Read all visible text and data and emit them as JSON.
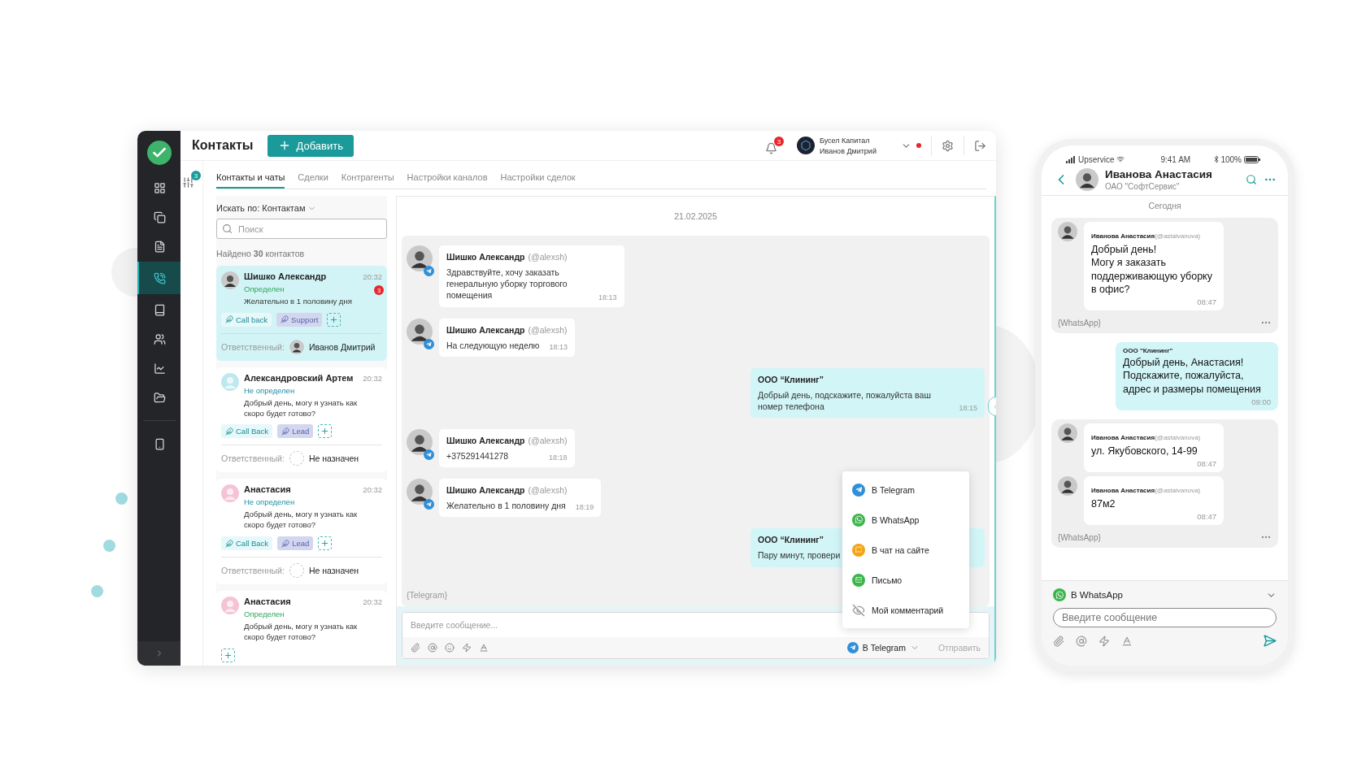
{
  "sidebar": {
    "items": [
      {
        "selected": false
      },
      {
        "selected": false
      },
      {
        "selected": false
      },
      {
        "selected": true
      },
      {
        "selected": false
      },
      {
        "selected": false
      },
      {
        "selected": false
      },
      {
        "selected": false
      },
      {
        "selected": false
      }
    ]
  },
  "header": {
    "title": "Контакты",
    "add_button": "Добавить",
    "notifications": "3",
    "company": "Бусел Капитал",
    "user": "Иванов Дмитрий"
  },
  "filter": {
    "badge": "3"
  },
  "tabs": [
    {
      "label": "Контакты и чаты",
      "selected": true
    },
    {
      "label": "Сделки",
      "selected": false
    },
    {
      "label": "Контрагенты",
      "selected": false
    },
    {
      "label": "Настройки каналов",
      "selected": false
    },
    {
      "label": "Настройки сделок",
      "selected": false
    }
  ],
  "search": {
    "label": "Искать по:",
    "value": "Контактам",
    "placeholder": "Поиск",
    "found": "Найдено **30** контактов"
  },
  "contacts": [
    {
      "name": "Шишко Александр",
      "time": "20:32",
      "avatar": {
        "kind": "photo"
      },
      "status": {
        "kind": "defined",
        "text": "Определен"
      },
      "preview": "Желательно в 1 половину дня",
      "unread": "3",
      "tags": [
        {
          "kind": "callback",
          "label": "Call back"
        },
        {
          "kind": "support",
          "label": "Support"
        }
      ],
      "owner_label": "Ответственный:",
      "owner": "Иванов Дмитрий",
      "owner_assigned": true,
      "selected": true
    },
    {
      "name": "Александровский Артем",
      "time": "20:32",
      "avatar": {
        "kind": "cartoon",
        "color": "#bfe8ee"
      },
      "status": {
        "kind": "undefined",
        "text": "Не определен"
      },
      "preview": "Добрый день, могу я узнать как скоро будет готово?",
      "tags": [
        {
          "kind": "callback",
          "label": "Call Back"
        },
        {
          "kind": "lead",
          "label": "Lead"
        }
      ],
      "owner_label": "Ответственный:",
      "owner": "Не назначен",
      "owner_assigned": false,
      "selected": false
    },
    {
      "name": "Анастасия",
      "time": "20:32",
      "avatar": {
        "kind": "cartoon",
        "color": "#f5c3d6"
      },
      "status": {
        "kind": "undefined",
        "text": "Не определен"
      },
      "preview": "Добрый день, могу я узнать как скоро будет готово?",
      "tags": [
        {
          "kind": "callback",
          "label": "Call Back"
        },
        {
          "kind": "lead",
          "label": "Lead"
        }
      ],
      "owner_label": "Ответственный:",
      "owner": "Не назначен",
      "owner_assigned": false,
      "selected": false
    },
    {
      "name": "Анастасия",
      "time": "20:32",
      "avatar": {
        "kind": "cartoon",
        "color": "#f5c3d6"
      },
      "status": {
        "kind": "defined",
        "text": "Определен"
      },
      "preview": "Добрый день, могу я узнать как скоро будет готово?",
      "selected": false
    }
  ],
  "chat": {
    "date": "21.02.2025",
    "messages": [
      {
        "kind": "in",
        "author": "Шишко Александр",
        "handle": "(@alexsh)",
        "text": "Здравствуйте, хочу заказать генеральную уборку торгового помещения",
        "time": "18:13"
      },
      {
        "kind": "in",
        "author": "Шишко Александр",
        "handle": "(@alexsh)",
        "text": "На следующую неделю",
        "time": "18:13"
      },
      {
        "kind": "out",
        "author": "ООО “Клининг”",
        "text": "Добрый день, подскажите, пожалуйста ваш номер телефона",
        "time": "18:15"
      },
      {
        "kind": "in",
        "author": "Шишко Александр",
        "handle": "(@alexsh)",
        "text": "+375291441278",
        "time": "18:18"
      },
      {
        "kind": "in",
        "author": "Шишко Александр",
        "handle": "(@alexsh)",
        "text": "Желательно в 1 половину дня",
        "time": "18:19"
      },
      {
        "kind": "out",
        "author": "ООО “Клининг”",
        "text": "Пару минут, провери"
      }
    ],
    "channel_label": "{Telegram}",
    "composer": {
      "placeholder": "Введите сообщение...",
      "channel": "В Telegram",
      "send": "Отправить"
    },
    "menu": [
      {
        "kind": "telegram",
        "label": "В Telegram"
      },
      {
        "kind": "whatsapp",
        "label": "В WhatsApp"
      },
      {
        "kind": "site",
        "label": "В чат на сайте"
      },
      {
        "kind": "mail",
        "label": "Письмо"
      },
      {
        "kind": "comment",
        "label": "Мой комментарий"
      }
    ]
  },
  "phone": {
    "status": {
      "carrier": "Upservice",
      "time": "9:41 AM",
      "battery": "100%"
    },
    "contact": {
      "name": "Иванова Анастасия",
      "company": "ОАО \"СофтСервис\""
    },
    "day": "Сегодня",
    "groups": [
      {
        "kind": "in",
        "channel": "{WhatsApp}",
        "messages": [
          {
            "author": "Иванова Анастасия",
            "handle": "(@astaivanova)",
            "text": "Добрый день!\nМогу я заказать\nподдерживающую уборку\nв офис?",
            "time": "08:47"
          }
        ]
      },
      {
        "kind": "out",
        "messages": [
          {
            "author": "ООО \"Клининг\"",
            "text": "Добрый день, Анастасия!\nПодскажите, пожалуйста,\nадрес и размеры помещения",
            "time": "09:00"
          }
        ]
      },
      {
        "kind": "in",
        "channel": "{WhatsApp}",
        "messages": [
          {
            "author": "Иванова Анастасия",
            "handle": "(@astaivanova)",
            "text": "ул. Якубовского, 14-99",
            "time": "08:47"
          },
          {
            "author": "Иванова Анастасия",
            "handle": "(@astaivanova)",
            "text": "87м2",
            "time": "08:47"
          }
        ]
      }
    ],
    "composer": {
      "channel": "В WhatsApp",
      "placeholder": "Введите сообщение"
    }
  }
}
